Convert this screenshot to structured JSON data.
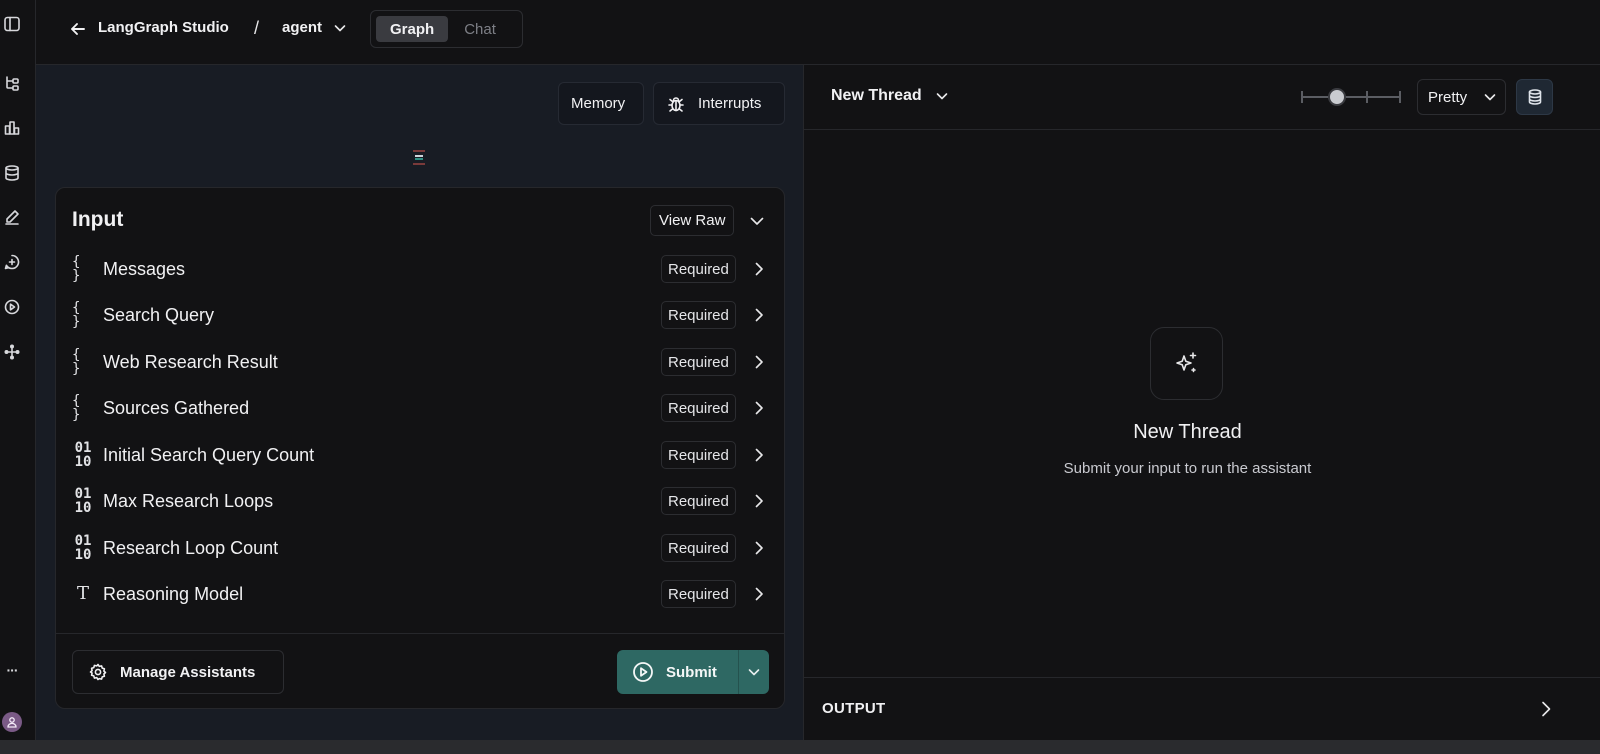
{
  "header": {
    "app_title": "LangGraph Studio",
    "breadcrumb_separator": "/",
    "graph_name": "agent",
    "view_tabs": [
      {
        "label": "Graph",
        "active": true
      },
      {
        "label": "Chat",
        "active": false
      }
    ]
  },
  "sidebar": {
    "icons": [
      "panel-toggle-icon",
      "graph-icon",
      "chart-icon",
      "database-icon",
      "pencil-icon",
      "chat-plus-icon",
      "play-icon",
      "nodes-icon",
      "more-icon",
      "user-avatar"
    ],
    "more_label": "···"
  },
  "graph_panel": {
    "memory_label": "Memory",
    "interrupts_label": "Interrupts"
  },
  "input_form": {
    "title": "Input",
    "view_raw_label": "View Raw",
    "fields": [
      {
        "label": "Messages",
        "type_icon": "braces-icon",
        "glyph": "{ }",
        "badge": "Required"
      },
      {
        "label": "Search Query",
        "type_icon": "braces-icon",
        "glyph": "{ }",
        "badge": "Required"
      },
      {
        "label": "Web Research Result",
        "type_icon": "braces-icon",
        "glyph": "{ }",
        "badge": "Required"
      },
      {
        "label": "Sources Gathered",
        "type_icon": "braces-icon",
        "glyph": "{ }",
        "badge": "Required"
      },
      {
        "label": "Initial Search Query Count",
        "type_icon": "binary-icon",
        "glyph": "01 10",
        "badge": "Required"
      },
      {
        "label": "Max Research Loops",
        "type_icon": "binary-icon",
        "glyph": "01 10",
        "badge": "Required"
      },
      {
        "label": "Research Loop Count",
        "type_icon": "binary-icon",
        "glyph": "01 10",
        "badge": "Required"
      },
      {
        "label": "Reasoning Model",
        "type_icon": "text-type-icon",
        "glyph": "T",
        "badge": "Required"
      }
    ],
    "manage_assistants_label": "Manage Assistants",
    "submit_label": "Submit"
  },
  "thread_panel": {
    "thread_select_label": "New Thread",
    "slider_value": 0.33,
    "render_mode": "Pretty",
    "empty_title": "New Thread",
    "empty_subtitle": "Submit your input to run the assistant",
    "output_label": "OUTPUT"
  },
  "colors": {
    "background": "#121214",
    "graph_panel_bg": "#181c24",
    "submit_accent": "#2e6863",
    "border": "#26272b"
  }
}
